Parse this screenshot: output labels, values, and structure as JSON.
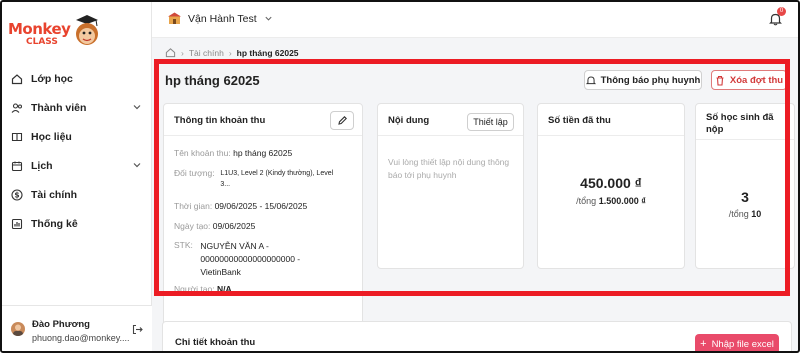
{
  "brand": {
    "name": "Monkey",
    "sub": "CLASS",
    "color": "#e8432e"
  },
  "org": {
    "name": "Vận Hành Test"
  },
  "notifications": {
    "count": "0"
  },
  "sidebar": {
    "items": [
      {
        "label": "Lớp học",
        "icon": "home-icon"
      },
      {
        "label": "Thành viên",
        "icon": "users-icon",
        "expandable": true
      },
      {
        "label": "Học liệu",
        "icon": "book-icon"
      },
      {
        "label": "Lịch",
        "icon": "calendar-icon",
        "expandable": true
      },
      {
        "label": "Tài chính",
        "icon": "dollar-icon"
      },
      {
        "label": "Thống kê",
        "icon": "stats-icon"
      }
    ]
  },
  "user": {
    "name": "Đào Phương",
    "email": "phuong.dao@monkey...."
  },
  "breadcrumb": {
    "parent": "Tài chính",
    "current": "hp tháng 62025"
  },
  "page": {
    "title": "hp tháng 62025",
    "notify_label": "Thông báo phụ huynh",
    "delete_label": "Xóa đợt thu"
  },
  "info": {
    "heading": "Thông tin khoản thu",
    "fee_name_key": "Tên khoản thu:",
    "fee_name": "hp tháng 62025",
    "target_key": "Đối tượng:",
    "target_line1": "L1U3, Level 2 (Kindy thường), Level",
    "target_line2": "3...",
    "time_key": "Thời gian:",
    "time": "09/06/2025 - 15/06/2025",
    "created_key": "Ngày tạo:",
    "created": "09/06/2025",
    "account_key": "STK:",
    "account_line1": "NGUYỄN VĂN A -",
    "account_line2": "00000000000000000000 -",
    "account_line3": "VietinBank",
    "creator_key": "Người tạo:",
    "creator": "N/A"
  },
  "content": {
    "heading": "Nội dung",
    "setup_label": "Thiết lập",
    "placeholder": "Vui lòng thiết lập nội dung thông báo tới phụ huynh"
  },
  "paid": {
    "heading": "Số tiền đã thu",
    "amount": "450.000 ₫",
    "total_prefix": "/tổng",
    "total": "1.500.000 ₫"
  },
  "students": {
    "heading_line1": "Số học sinh đã",
    "heading_line2": "nộp",
    "count": "3",
    "total_prefix": "/tổng",
    "total": "10"
  },
  "detail": {
    "heading": "Chi tiết khoản thu",
    "import_label": "Nhập file excel"
  },
  "colors": {
    "highlight": "#ec1c24",
    "accent": "#e94b6a",
    "danger": "#d23a3a"
  }
}
